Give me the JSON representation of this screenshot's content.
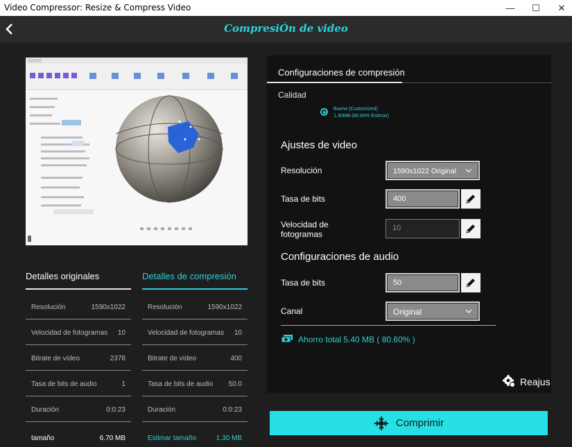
{
  "window": {
    "title": "Video Compressor: Resize & Compress Video",
    "minimize_glyph": "—",
    "maximize_glyph": "☐",
    "close_glyph": "✕"
  },
  "header": {
    "title": "CompresiÓn de video"
  },
  "tabs": {
    "original": "Detalles originales",
    "compressed": "Detalles de compresión"
  },
  "original_details": [
    {
      "label": "Resolución",
      "value": "1590x1022"
    },
    {
      "label": "Velocidad de fotogramas",
      "value": "10"
    },
    {
      "label": "Bitrate de vídeo",
      "value": "2378"
    },
    {
      "label": "Tasa de bits de audio",
      "value": "1"
    },
    {
      "label": "Duración",
      "value": "0:0:23"
    },
    {
      "label": "tamaño",
      "value": "6.70 MB"
    }
  ],
  "compressed_details": [
    {
      "label": "Resolución",
      "value": "1590x1022"
    },
    {
      "label": "Velocidad de fotogramas",
      "value": "10"
    },
    {
      "label": "Bitrate de vídeo",
      "value": "400"
    },
    {
      "label": "Tasa de bits de audio",
      "value": "50.0"
    },
    {
      "label": "Duración",
      "value": "0:0:23"
    },
    {
      "label": "Estimar tamaño",
      "value": "1.30 MB"
    }
  ],
  "settings": {
    "header": "Configuraciones de compresión",
    "quality_label": "Calidad",
    "quality_option": "Bueno (Customized)",
    "quality_detail": "1.30MB (80.60% Estimar)",
    "video_section": "Ajustes de video",
    "resolution_label": "Resolución",
    "resolution_value": "1590x1022 Original",
    "video_bitrate_label": "Tasa de bits",
    "video_bitrate_value": "400",
    "framerate_label_1": "Velocidad de",
    "framerate_label_2": "fotogramas",
    "framerate_value": "10",
    "audio_section": "Configuraciones de audio",
    "audio_bitrate_label": "Tasa de bits",
    "audio_bitrate_value": "50",
    "channel_label": "Canal",
    "channel_value": "Original",
    "savings": "Ahorro total 5.40 MB ( 80.60% )",
    "readjust": "Reajus"
  },
  "compress_button": "Comprimir",
  "colors": {
    "accent": "#2fd0d8",
    "button": "#26e0e6",
    "panel": "#121212",
    "background": "#1e1e1e"
  }
}
